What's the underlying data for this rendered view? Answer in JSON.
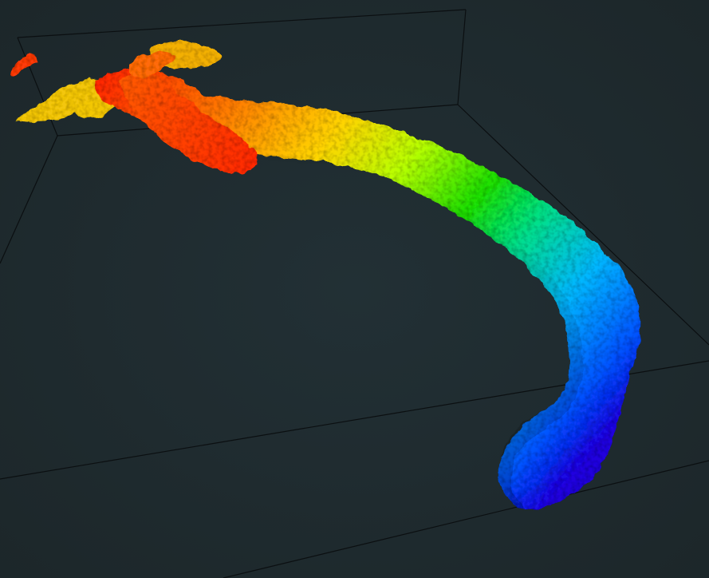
{
  "viewer": {
    "background": "#1c2629",
    "background_center": "#223035",
    "bounding_box_color": "#0b0f11",
    "colormap": [
      "#ff2a00",
      "#ff7a00",
      "#ffd400",
      "#b8ff00",
      "#22e000",
      "#00e08a",
      "#00b7ff",
      "#0055ff",
      "#2200dd"
    ],
    "colormap_name": "jet (elevation)"
  }
}
